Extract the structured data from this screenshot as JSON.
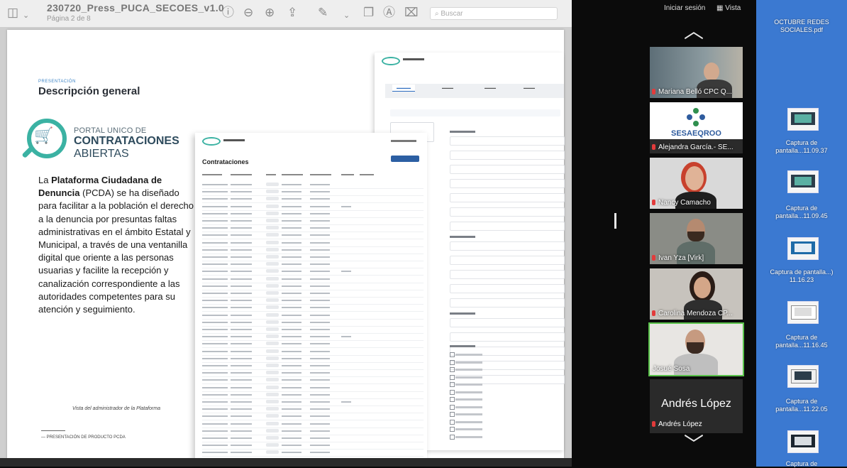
{
  "viewer": {
    "doc_title": "230720_Press_PUCA_SECOES_v1.0",
    "page_label": "Página 2 de 8",
    "search_placeholder": "Buscar",
    "slide": {
      "kicker": "PRESENTACIÓN",
      "heading": "Descripción general",
      "portal_line1": "PORTAL UNICO DE",
      "portal_line2": "CONTRATACIONES",
      "portal_line3": "ABIERTAS",
      "body_bold1": "Plataforma Ciudadana de Denuncia",
      "body_pre": "La ",
      "body_post": " (PCDA) se ha diseñado para facilitar a la población el derecho a la denuncia por presuntas faltas administrativas en el ámbito Estatal y Municipal, a través de una ventanilla digital que oriente a las personas usuarias y facilite la recepción y canalización correspondiente a las autoridades competentes para su atención y seguimiento.",
      "caption": "Vista del administrador de la Plataforma",
      "footer": "— PRESENTACIÓN DE PRODUCTO PCDA",
      "table_title": "Contrataciones"
    }
  },
  "meeting": {
    "start_session": "Iniciar sesión",
    "view": "Vista",
    "participants": [
      {
        "name": "Mariana Belló CPC Q...",
        "muted": true
      },
      {
        "name": "Alejandra García.- SE...",
        "muted": true
      },
      {
        "name": "Nancy Camacho",
        "muted": true
      },
      {
        "name": "Ivan Yza [Virk]",
        "muted": true
      },
      {
        "name": "Carolina Mendoza CP...",
        "muted": true
      },
      {
        "name": "Josué Sosa",
        "muted": false
      }
    ],
    "logo_text": "SESAEQROO",
    "speaker_big": "Andrés López",
    "speaker_small": "Andrés López"
  },
  "desktop": {
    "files": [
      {
        "label": "OCTUBRE REDES SOCIALES.pdf"
      },
      {
        "label": "Captura de pantalla...11.09.37"
      },
      {
        "label": "Captura de pantalla...11.09.45"
      },
      {
        "label": "Captura de pantalla...) 11.16.23"
      },
      {
        "label": "Captura de pantalla...11.16.45"
      },
      {
        "label": "Captura de pantalla...11.22.05"
      },
      {
        "label": "Captura de"
      }
    ]
  },
  "colors": {
    "accent_teal": "#3bb2a3",
    "desktop_blue": "#3b79d1",
    "active_speaker": "#59c14a",
    "muted_red": "#e23b3b"
  }
}
